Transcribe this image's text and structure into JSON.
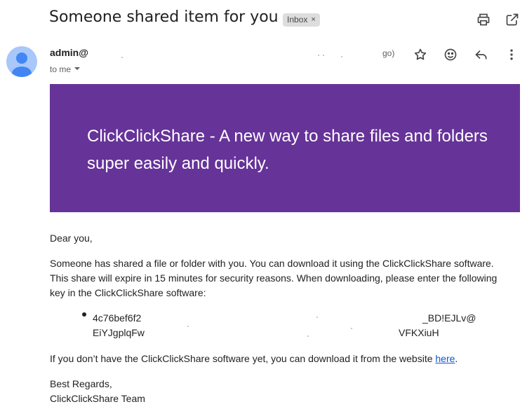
{
  "subject": "Someone shared item for you",
  "label_chip": {
    "text": "Inbox",
    "remove": "×"
  },
  "sender": {
    "name": "admin@",
    "time_fragment": "go)",
    "to_label": "to me"
  },
  "banner": {
    "background": "#663399",
    "text": "ClickClickShare - A new way to share files and folders super easily and quickly."
  },
  "body": {
    "greeting": "Dear you,",
    "paragraph_line1": "Someone has shared a file or folder with you. You can download it using the ClickClickShare software.",
    "paragraph_line2": "This share will expire in 15 minutes for security reasons. When downloading, please enter the following",
    "paragraph_line3": "key in the ClickClickShare software:",
    "key_line1_start": "4c76bef6f2",
    "key_line1_end": "_BD!EJLv@",
    "key_line2_start": "EiYJgplqFw",
    "key_line2_end": "VFKXiuH",
    "download_prefix": "If you don’t have the ClickClickShare software yet, you can download it from the website ",
    "download_link": "here",
    "download_suffix": ".",
    "closing": "Best Regards,",
    "signature": "ClickClickShare Team"
  },
  "icons": {
    "header": [
      "print-icon",
      "open-in-new-window-icon"
    ],
    "actions": [
      "star-icon",
      "emoji-reaction-icon",
      "reply-icon",
      "more-vert-icon"
    ]
  }
}
